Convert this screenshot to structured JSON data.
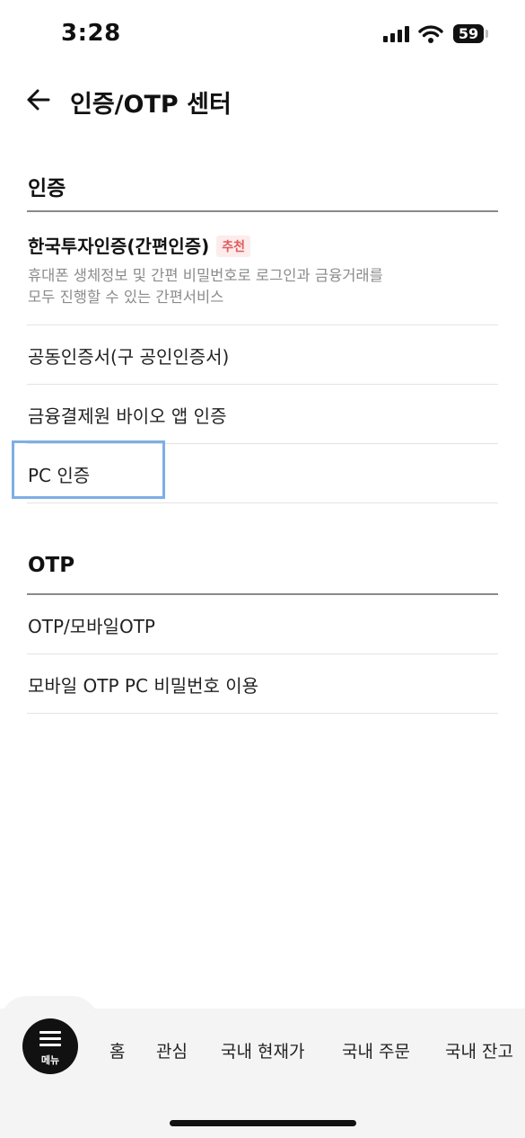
{
  "status": {
    "time": "3:28",
    "battery": "59"
  },
  "header": {
    "title": "인증/OTP 센터"
  },
  "sections": {
    "auth": {
      "title": "인증",
      "featured": {
        "label": "한국투자인증(간편인증)",
        "badge": "추천",
        "desc_line1": "휴대폰 생체정보 및 간편 비밀번호로 로그인과 금융거래를",
        "desc_line2": "모두 진행할 수 있는 간편서비스"
      },
      "items": [
        "공동인증서(구 공인인증서)",
        "금융결제원 바이오 앱 인증",
        "PC 인증"
      ]
    },
    "otp": {
      "title": "OTP",
      "items": [
        "OTP/모바일OTP",
        "모바일 OTP PC 비밀번호 이용"
      ]
    }
  },
  "bottom_nav": {
    "menu_label": "메뉴",
    "items": [
      "홈",
      "관심",
      "국내 현재가",
      "국내 주문",
      "국내 잔고"
    ]
  }
}
